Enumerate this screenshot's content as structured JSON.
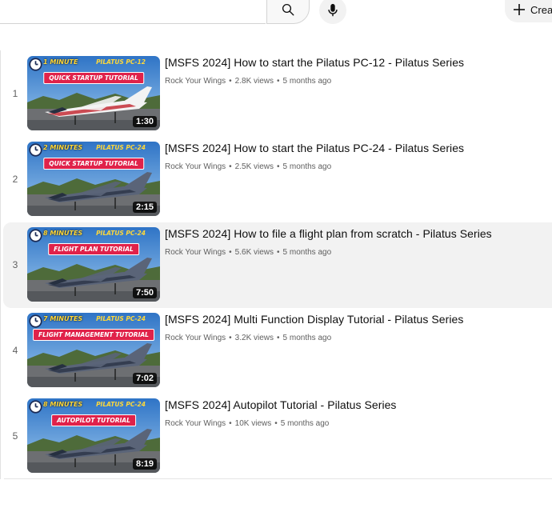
{
  "header": {
    "search_icon": "search-icon",
    "mic_icon": "microphone-icon",
    "create_label": "Create"
  },
  "videos": [
    {
      "index": "1",
      "title": "[MSFS 2024] How to start the Pilatus PC-12 - Pilatus Series",
      "channel": "Rock Your Wings",
      "views": "2.8K views",
      "age": "5 months ago",
      "duration": "1:30",
      "thumb_minutes": "1 MINUTE",
      "thumb_model": "PILATUS PC-12",
      "thumb_tutorial": "QUICK STARTUP TUTORIAL",
      "active": false
    },
    {
      "index": "2",
      "title": "[MSFS 2024] How to start the Pilatus PC-24 - Pilatus Series",
      "channel": "Rock Your Wings",
      "views": "2.5K views",
      "age": "5 months ago",
      "duration": "2:15",
      "thumb_minutes": "2 MINUTES",
      "thumb_model": "PILATUS PC-24",
      "thumb_tutorial": "QUICK STARTUP TUTORIAL",
      "active": false
    },
    {
      "index": "3",
      "title": "[MSFS 2024] How to file a flight plan from scratch - Pilatus Series",
      "channel": "Rock Your Wings",
      "views": "5.6K views",
      "age": "5 months ago",
      "duration": "7:50",
      "thumb_minutes": "8 MINUTES",
      "thumb_model": "PILATUS PC-24",
      "thumb_tutorial": "FLIGHT PLAN TUTORIAL",
      "active": true
    },
    {
      "index": "4",
      "title": "[MSFS 2024] Multi Function Display Tutorial - Pilatus Series",
      "channel": "Rock Your Wings",
      "views": "3.2K views",
      "age": "5 months ago",
      "duration": "7:02",
      "thumb_minutes": "7 MINUTES",
      "thumb_model": "PILATUS PC-24",
      "thumb_tutorial": "FLIGHT MANAGEMENT TUTORIAL",
      "active": false
    },
    {
      "index": "5",
      "title": "[MSFS 2024] Autopilot Tutorial - Pilatus Series",
      "channel": "Rock Your Wings",
      "views": "10K views",
      "age": "5 months ago",
      "duration": "8:19",
      "thumb_minutes": "8 MINUTES",
      "thumb_model": "PILATUS PC-24",
      "thumb_tutorial": "AUTOPILOT TUTORIAL",
      "active": false
    }
  ],
  "colors": {
    "tutorial_banner": "#e0224a",
    "minutes_text": "#ffd83a",
    "sky": "#3f86d4",
    "mountains": "#4e6b3a",
    "active_row": "#f2f2f2"
  }
}
